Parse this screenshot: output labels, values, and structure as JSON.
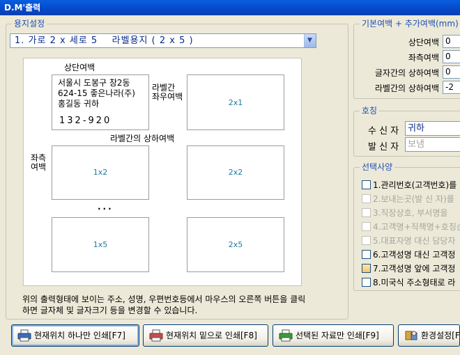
{
  "window": {
    "title": "D.M'출력"
  },
  "paper": {
    "group_title": "용지설정",
    "selected": "1. 가로 2 x 세로 5    라벨용지 ( 2 x 5 )"
  },
  "preview": {
    "top_margin_label": "상단여백",
    "label_side_margin": "라벨간\n좌우여백",
    "label_vertical_margin": "라벨간의 상하여백",
    "left_margin_label": "좌측\n여백",
    "address_lines": "서울시 도봉구 창2동\n624-15 좋은나라(주)\n홍길동 귀하",
    "zip": "132-920",
    "cells": [
      "2x1",
      "1x2",
      "2x2",
      "1x5",
      "2x5"
    ],
    "ellipsis": "..."
  },
  "note": "위의 출력형태에 보이는 주소, 성명, 우편번호등에서 마우스의 오른쪽 버튼을 클릭하면 글자체 및 글자크기 등을 변경할 수 있습니다.",
  "margins": {
    "group_title": "기본여백 + 추가여백(mm)",
    "fields": [
      {
        "label": "상단여백",
        "value": "0"
      },
      {
        "label": "좌측여백",
        "value": "0"
      },
      {
        "label": "글자간의 상하여백",
        "value": "0"
      },
      {
        "label": "라벨간의 상하여백",
        "value": "-2"
      }
    ]
  },
  "honorific": {
    "group_title": "호칭",
    "recipient_label": "수 신 자",
    "recipient_value": "귀하",
    "sender_label": "발 신 자",
    "sender_placeholder": "보냄"
  },
  "options": {
    "group_title": "선택사양",
    "items": [
      {
        "label": "1.관리번호(고객번호)를",
        "enabled": true
      },
      {
        "label": "2.보내는곳(발 신 자)를",
        "enabled": false
      },
      {
        "label": "3.직장상호, 부서명을",
        "enabled": false
      },
      {
        "label": "4.고객명+직책명+호칭순",
        "enabled": false
      },
      {
        "label": "5.대표자명 대신 담당자",
        "enabled": false
      },
      {
        "label": "6.고객성명 대신 고객정",
        "enabled": true
      },
      {
        "label": "7.고객성명 앞에 고객정",
        "enabled": true
      },
      {
        "label": "8.미국식 주소형태로 라",
        "enabled": true
      }
    ]
  },
  "buttons": {
    "print_current": "현재위치 하나만 인쇄[F7]",
    "print_below": "현재위치 밑으로 인쇄[F8]",
    "print_selected": "선택된 자료만 인쇄[F9]",
    "settings": "환경설정[F"
  },
  "colors": {
    "title_bar": "#0548c8",
    "group_title": "#1f4fb4",
    "cell_number": "#1d7aa0"
  }
}
